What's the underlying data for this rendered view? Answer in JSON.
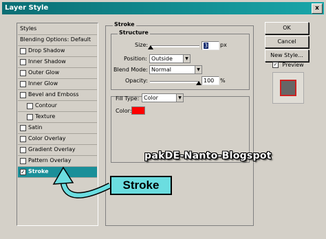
{
  "window": {
    "title": "Layer Style",
    "close": "x"
  },
  "styles_list": {
    "header": "Styles",
    "blending": "Blending Options: Default",
    "items": [
      {
        "label": "Drop Shadow",
        "checked": false,
        "indent": 0
      },
      {
        "label": "Inner Shadow",
        "checked": false,
        "indent": 0
      },
      {
        "label": "Outer Glow",
        "checked": false,
        "indent": 0
      },
      {
        "label": "Inner Glow",
        "checked": false,
        "indent": 0
      },
      {
        "label": "Bevel and Emboss",
        "checked": false,
        "indent": 0
      },
      {
        "label": "Contour",
        "checked": false,
        "indent": 1
      },
      {
        "label": "Texture",
        "checked": false,
        "indent": 1
      },
      {
        "label": "Satin",
        "checked": false,
        "indent": 0
      },
      {
        "label": "Color Overlay",
        "checked": false,
        "indent": 0
      },
      {
        "label": "Gradient Overlay",
        "checked": false,
        "indent": 0
      },
      {
        "label": "Pattern Overlay",
        "checked": false,
        "indent": 0
      },
      {
        "label": "Stroke",
        "checked": true,
        "indent": 0,
        "selected": true
      }
    ]
  },
  "stroke": {
    "group_title": "Stroke",
    "structure_title": "Structure",
    "size_label": "Size:",
    "size_value": "3",
    "size_unit": "px",
    "position_label": "Position:",
    "position_value": "Outside",
    "blend_label": "Blend Mode:",
    "blend_value": "Normal",
    "opacity_label": "Opacity:",
    "opacity_value": "100",
    "opacity_unit": "%",
    "fill_label": "Fill Type:",
    "fill_value": "Color",
    "color_label": "Color:",
    "color_swatch": "#ff0000"
  },
  "buttons": {
    "ok": "OK",
    "cancel": "Cancel",
    "new_style": "New Style...",
    "preview": "Preview",
    "preview_checked": true
  },
  "overlay": {
    "watermark": "pakDE-Nanto-Blogspot",
    "callout": "Stroke"
  },
  "colors": {
    "title_bar": "#0a6e74",
    "selection": "#1a8f99",
    "callout": "#6bdde0",
    "preview_swatch": "#666666",
    "preview_border": "#cc2222"
  }
}
